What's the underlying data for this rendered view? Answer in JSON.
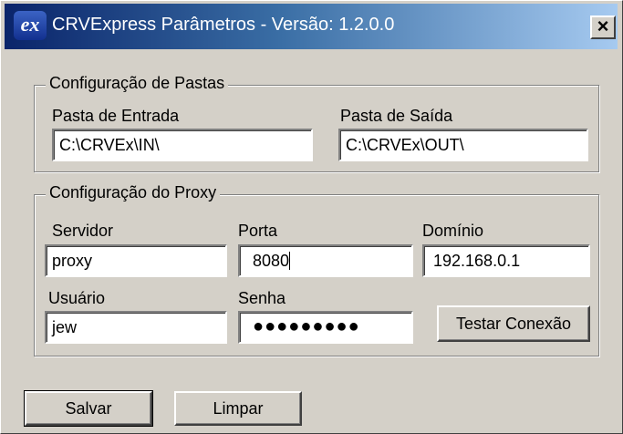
{
  "window": {
    "title": "CRVExpress Parâmetros - Versão: 1.2.0.0",
    "icon_text": "ex",
    "close_glyph": "×"
  },
  "folders": {
    "legend": "Configuração de Pastas",
    "input_label": "Pasta de Entrada",
    "input_value": "C:\\CRVEx\\IN\\",
    "output_label": "Pasta de Saída",
    "output_value": "C:\\CRVEx\\OUT\\"
  },
  "proxy": {
    "legend": "Configuração do Proxy",
    "server_label": "Servidor",
    "server_value": "proxy",
    "port_label": "Porta",
    "port_value": "8080",
    "domain_label": "Domínio",
    "domain_value": "192.168.0.1",
    "user_label": "Usuário",
    "user_value": "jew",
    "password_label": "Senha",
    "password_value": "●●●●●●●●●",
    "test_button": "Testar Conexão"
  },
  "footer": {
    "save_button": "Salvar",
    "clear_button": "Limpar"
  }
}
